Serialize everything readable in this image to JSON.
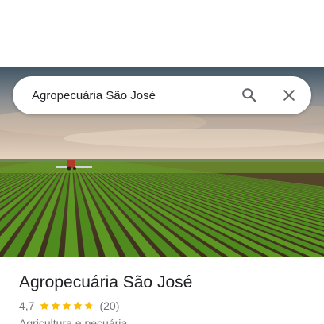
{
  "search": {
    "query": "Agropecuária São José",
    "search_icon": "search-icon",
    "close_icon": "close-icon"
  },
  "hero": {
    "image": "farm-field-with-tractor"
  },
  "place": {
    "name": "Agropecuária São José",
    "rating": "4,7",
    "rating_value": 4.7,
    "max_rating": 5,
    "review_count": "(20)",
    "category": "Agricultura e pecuária"
  },
  "colors": {
    "star": "#fbbc04",
    "title": "#202124",
    "secondary_text": "#70757a"
  }
}
